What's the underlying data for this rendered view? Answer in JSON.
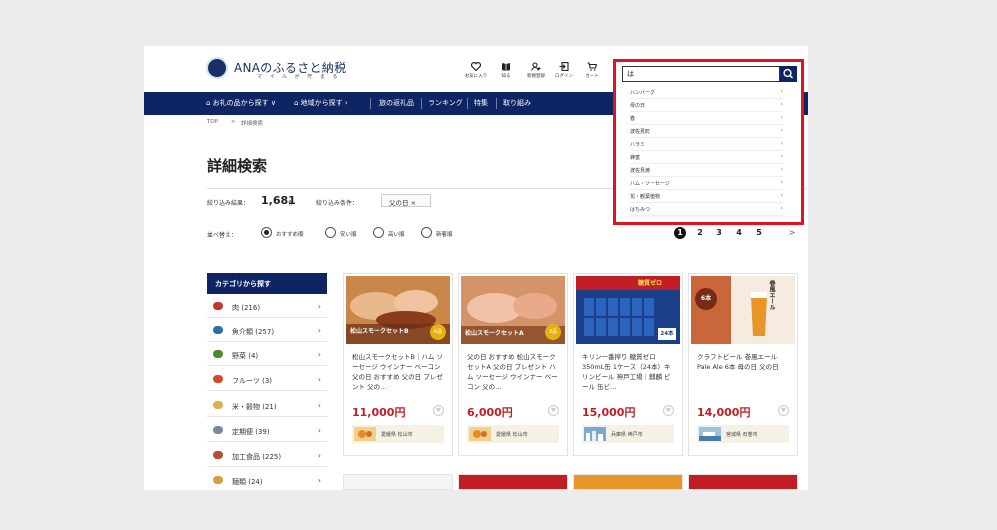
{
  "header": {
    "logo_text": "ANAのふるさと納税",
    "logo_sub": "マ イ ル が 貯 ま る",
    "icons": [
      {
        "name": "favorite",
        "label": "お気に入り"
      },
      {
        "name": "guide",
        "label": "知る"
      },
      {
        "name": "register",
        "label": "新規登録"
      },
      {
        "name": "login",
        "label": "ログイン"
      },
      {
        "name": "cart",
        "label": "カート"
      }
    ]
  },
  "nav": {
    "items": [
      "お礼の品から探す",
      "地域から探す",
      "旅の返礼品",
      "ランキング",
      "特集",
      "取り組み"
    ]
  },
  "breadcrumb": {
    "home": "TOP",
    "sep": ">",
    "current": "詳細検索"
  },
  "page_title": "詳細検索",
  "filter": {
    "result_label": "絞り込み結果：",
    "count": "1,681",
    "unit": "件",
    "condition_label": "絞り込み条件：",
    "chip": "父の日 ×"
  },
  "sort": {
    "label": "並べ替え：",
    "options": [
      "おすすめ順",
      "安い順",
      "高い順",
      "新着順"
    ],
    "selected": "おすすめ順"
  },
  "pagination": [
    "1",
    "2",
    "3",
    "4",
    "5",
    ">"
  ],
  "sidebar": {
    "heading": "カテゴリから探す",
    "items": [
      {
        "label": "肉 (216)",
        "color": "#c0392b"
      },
      {
        "label": "魚介類 (257)",
        "color": "#2e6fa8"
      },
      {
        "label": "野菜 (4)",
        "color": "#4a8c2a"
      },
      {
        "label": "フルーツ (3)",
        "color": "#d24a2a"
      },
      {
        "label": "米・穀物 (21)",
        "color": "#d9b24a"
      },
      {
        "label": "定期便 (39)",
        "color": "#7a8aa0"
      },
      {
        "label": "加工食品 (225)",
        "color": "#b0503a"
      },
      {
        "label": "麺類 (24)",
        "color": "#d9a040"
      }
    ]
  },
  "products": [
    {
      "name": "松山スモークセットB｜ハム ソーセージ ウインナー ベーコン 父の日 おすすめ 父の日 プレゼント 父の…",
      "price": "11,000円",
      "location": "愛媛県 松山市",
      "img_text": "松山スモークセットB",
      "badge": "6品"
    },
    {
      "name": "父の日 おすすめ 松山スモークセットA 父の日 プレゼント ハム ソーセージ ウインナー ベーコン 父の…",
      "price": "6,000円",
      "location": "愛媛県 松山市",
      "img_text": "松山スモークセットA",
      "badge": "3品"
    },
    {
      "name": "キリン一番搾り 糖質ゼロ 350mL缶 1ケース（24本）キリンビール 神戸工場｜麒麟 ビール 缶ビ…",
      "price": "15,000円",
      "location": "兵庫県 神戸市",
      "img_text": "糖質ゼロ",
      "badge": "24本"
    },
    {
      "name": "クラフトビール 巻風エール Pale Ale 6本 母の日 父の日",
      "price": "14,000円",
      "location": "宮城県 石巻市",
      "img_text": "巻風エール",
      "badge": "6本"
    }
  ],
  "search": {
    "value": "は",
    "suggestions": [
      "ハンバーグ",
      "母の日",
      "春",
      "波佐見町",
      "ハラミ",
      "蜂蜜",
      "波佐見焼",
      "ハム・ソーセージ",
      "花・観葉植物",
      "はちみつ"
    ]
  },
  "colors": {
    "navy": "#0e2463",
    "price_red": "#c01d25",
    "highlight_red": "#e0141e",
    "accent_yellow": "#e6b10b"
  }
}
